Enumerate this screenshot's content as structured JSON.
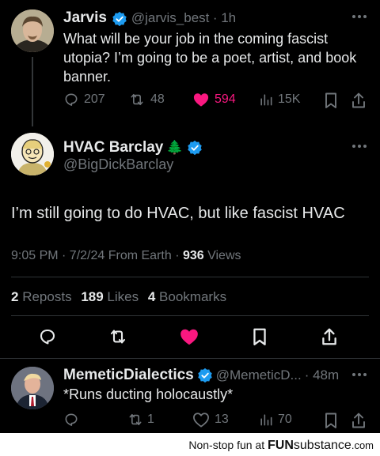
{
  "tweet1": {
    "display_name": "Jarvis",
    "handle": "@jarvis_best",
    "time": "· 1h",
    "text": "What will be your job in the coming fascist utopia? I’m going to be a poet, artist, and book banner.",
    "replies": "207",
    "reposts": "48",
    "likes": "594",
    "views": "15K"
  },
  "main": {
    "display_name": "HVAC Barclay",
    "name_emoji": "🌲",
    "handle": "@BigDickBarclay",
    "text": "I’m still going to do HVAC, but like fascist HVAC",
    "meta_time": "9:05 PM · 7/2/24 From Earth · ",
    "views_count": "936",
    "views_label": " Views",
    "reposts_count": "2",
    "reposts_label": "Reposts",
    "likes_count": "189",
    "likes_label": "Likes",
    "bookmarks_count": "4",
    "bookmarks_label": "Bookmarks"
  },
  "reply": {
    "display_name": "MemeticDialectics",
    "handle": "@MemeticD...",
    "time": "· 48m",
    "text": "*Runs ducting holocaustly*",
    "reposts": "1",
    "likes": "13",
    "views": "70"
  },
  "footer": {
    "text": "Non-stop fun at",
    "brand_bold": "FUN",
    "brand_rest": "substance",
    "brand_tld": ".com"
  },
  "colors": {
    "verified": "#1d9bf0",
    "like": "#f91880",
    "text": "#e7e9ea",
    "muted": "#71767b"
  },
  "icons": [
    "verified-badge-icon",
    "more-icon",
    "reply-icon",
    "repost-icon",
    "heart-icon",
    "views-icon",
    "bookmark-icon",
    "share-icon",
    "tree-emoji-icon"
  ]
}
